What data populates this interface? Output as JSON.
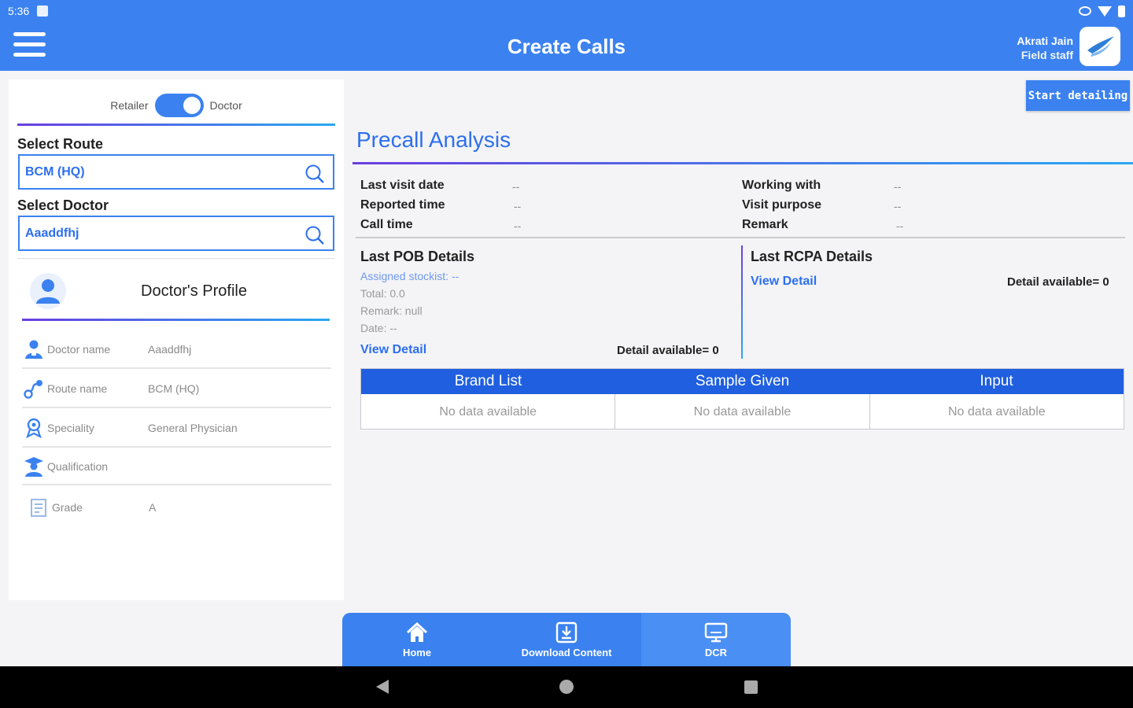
{
  "status_bar": {
    "time": "5:36"
  },
  "header": {
    "title": "Create Calls",
    "user_name": "Akrati Jain",
    "user_role": "Field staff"
  },
  "toggle": {
    "left_label": "Retailer",
    "right_label": "Doctor",
    "state": "Doctor"
  },
  "route": {
    "label": "Select Route",
    "value": "BCM (HQ)"
  },
  "doctor": {
    "label": "Select Doctor",
    "value": "Aaaddfhj"
  },
  "profile": {
    "title": "Doctor's Profile",
    "rows": [
      {
        "icon": "doctor-icon",
        "key": "Doctor name",
        "value": "Aaaddfhj"
      },
      {
        "icon": "route-icon",
        "key": "Route name",
        "value": "BCM (HQ)"
      },
      {
        "icon": "specialty-icon",
        "key": "Speciality",
        "value": "General Physician"
      },
      {
        "icon": "qualification-icon",
        "key": "Qualification",
        "value": ""
      },
      {
        "icon": "grade-icon",
        "key": "Grade",
        "value": "A"
      }
    ]
  },
  "actions": {
    "start_detailing": "Start detailing"
  },
  "precall": {
    "title": "Precall Analysis",
    "left_fields": [
      {
        "key": "Last visit date",
        "value": "--"
      },
      {
        "key": "Reported time",
        "value": "--"
      },
      {
        "key": "Call time",
        "value": "--"
      }
    ],
    "right_fields": [
      {
        "key": "Working with",
        "value": "--"
      },
      {
        "key": "Visit purpose",
        "value": "--"
      },
      {
        "key": "Remark",
        "value": "--"
      }
    ],
    "pob": {
      "title": "Last POB Details",
      "assigned_stockist": "Assigned stockist: --",
      "total": "Total: 0.0",
      "remark": "Remark: null",
      "date": "Date: --",
      "view_detail": "View Detail",
      "detail_available": "Detail available= 0"
    },
    "rcpa": {
      "title": "Last RCPA Details",
      "view_detail": "View Detail",
      "detail_available": "Detail available= 0"
    },
    "table": {
      "headers": [
        "Brand List",
        "Sample Given",
        "Input"
      ],
      "row": [
        "No data available",
        "No data available",
        "No data available"
      ]
    }
  },
  "bottom_nav": [
    {
      "label": "Home",
      "icon": "home-icon"
    },
    {
      "label": "Download Content",
      "icon": "download-icon"
    },
    {
      "label": "DCR",
      "icon": "monitor-icon"
    }
  ],
  "colors": {
    "primary": "#3b82f0",
    "table_header": "#1f5fe0",
    "link": "#2d6ff0"
  }
}
